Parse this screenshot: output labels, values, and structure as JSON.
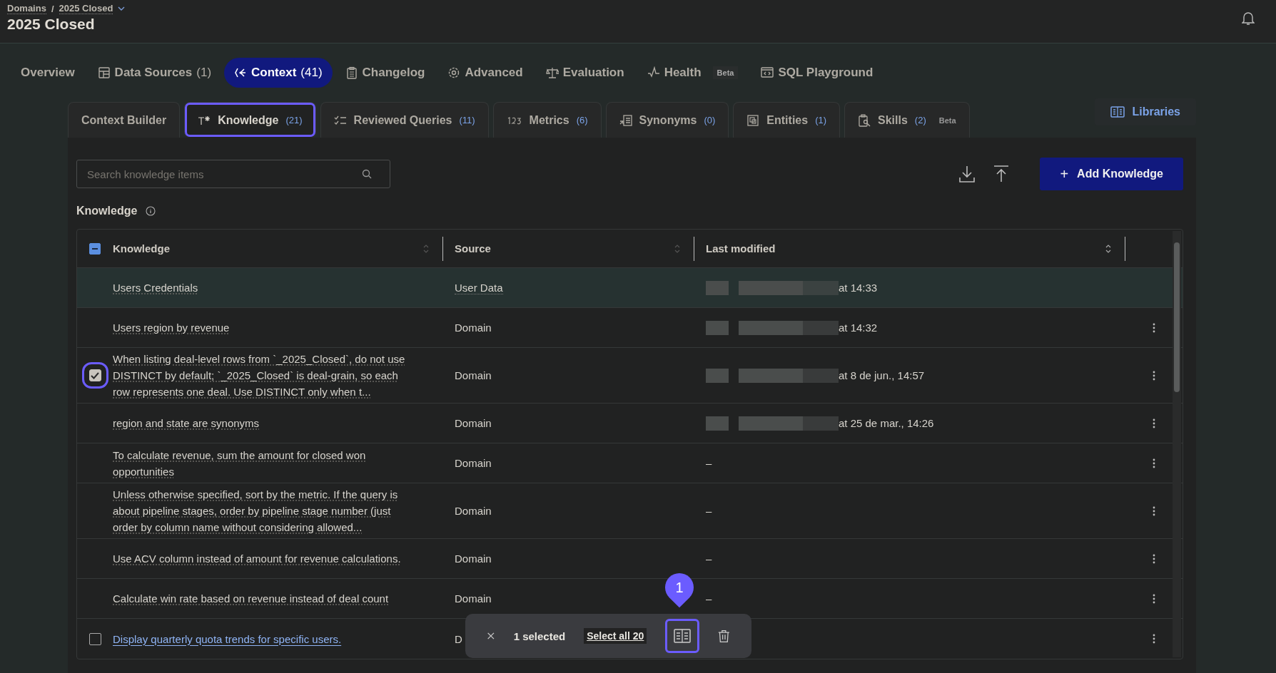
{
  "breadcrumb": [
    {
      "label": "Domains"
    },
    {
      "separator": "/",
      "label": "2025 Closed"
    }
  ],
  "title": "2025 Closed",
  "tabs": [
    {
      "label": "Overview",
      "selected": false
    },
    {
      "label": "Data Sources",
      "count": "(1)",
      "selected": false
    },
    {
      "label": "Context",
      "count": "(41)",
      "selected": true
    },
    {
      "label": "Changelog",
      "selected": false
    },
    {
      "label": "Advanced",
      "selected": false
    },
    {
      "label": "Evaluation",
      "selected": false
    },
    {
      "label": "Health",
      "badge": "Beta",
      "selected": false
    },
    {
      "label": "SQL Playground",
      "selected": false
    }
  ],
  "subtabs": [
    {
      "label": "Context Builder",
      "selected": false,
      "highlighted": false
    },
    {
      "label": "Knowledge",
      "count": "(21)",
      "selected": true,
      "highlighted": true
    },
    {
      "label": "Reviewed Queries",
      "count": "(11)",
      "selected": false,
      "highlighted": false
    },
    {
      "label": "Metrics",
      "count": "(6)",
      "selected": false,
      "highlighted": false
    },
    {
      "label": "Synonyms",
      "count": "(0)",
      "selected": false,
      "highlighted": false
    },
    {
      "label": "Entities",
      "count": "(1)",
      "selected": false,
      "highlighted": false
    },
    {
      "label": "Skills",
      "count": "(2)",
      "badge": "Beta",
      "selected": false,
      "highlighted": false
    }
  ],
  "libraries_button": "Libraries",
  "search": {
    "placeholder": "Search knowledge items"
  },
  "add_button": {
    "icon": "+",
    "label": "Add Knowledge"
  },
  "section_title": "Knowledge",
  "table": {
    "select_all_partial": true,
    "columns": [
      "Knowledge",
      "Source",
      "Last modified"
    ],
    "rows": [
      {
        "text": "Users Credentials",
        "source": "User Data",
        "modified": "at 14:33",
        "redacted": true,
        "checked": false,
        "hovered": true,
        "focused": false,
        "menu": false,
        "highlighted": false
      },
      {
        "text": "Users region by revenue",
        "source": "Domain",
        "modified": "at 14:32",
        "redacted": true,
        "checked": false,
        "hovered": false,
        "focused": false,
        "menu": true,
        "highlighted": false
      },
      {
        "text": "When listing deal-level rows from `_2025_Closed`, do not use DISTINCT by default; `_2025_Closed` is deal-grain, so each row represents one deal. Use DISTINCT only when t...",
        "source": "Domain",
        "modified": "at 8 de jun., 14:57",
        "redacted": true,
        "checked": true,
        "hovered": false,
        "focused": false,
        "menu": true,
        "highlighted": true
      },
      {
        "text": "region and state are synonyms",
        "source": "Domain",
        "modified": "at 25 de mar., 14:26",
        "redacted": true,
        "checked": false,
        "hovered": false,
        "focused": false,
        "menu": true,
        "highlighted": false
      },
      {
        "text": "To calculate revenue, sum the amount for closed won opportunities",
        "source": "Domain",
        "modified": "–",
        "redacted": false,
        "checked": false,
        "hovered": false,
        "focused": false,
        "menu": true,
        "highlighted": false
      },
      {
        "text": "Unless otherwise specified, sort by the metric. If the query is about pipeline stages, order by pipeline stage number (just order by column name without considering allowed...",
        "source": "Domain",
        "modified": "–",
        "redacted": false,
        "checked": false,
        "hovered": false,
        "focused": false,
        "menu": true,
        "highlighted": false
      },
      {
        "text": "Use ACV column instead of amount for revenue calculations.",
        "source": "Domain",
        "modified": "–",
        "redacted": false,
        "checked": false,
        "hovered": false,
        "focused": false,
        "menu": true,
        "highlighted": false
      },
      {
        "text": "Calculate win rate based on revenue instead of deal count",
        "source": "Domain",
        "modified": "–",
        "redacted": false,
        "checked": false,
        "hovered": false,
        "focused": false,
        "menu": true,
        "highlighted": false
      },
      {
        "text": "Display quarterly quota trends for specific users.",
        "source": "D",
        "redacted": false,
        "checked": false,
        "hovered": false,
        "focused": true,
        "menu": true,
        "highlighted": false
      }
    ]
  },
  "selection_bar": {
    "count_label": "1 selected",
    "select_all": "Select all 20",
    "book_highlighted": true
  },
  "marker": {
    "label": "1"
  }
}
